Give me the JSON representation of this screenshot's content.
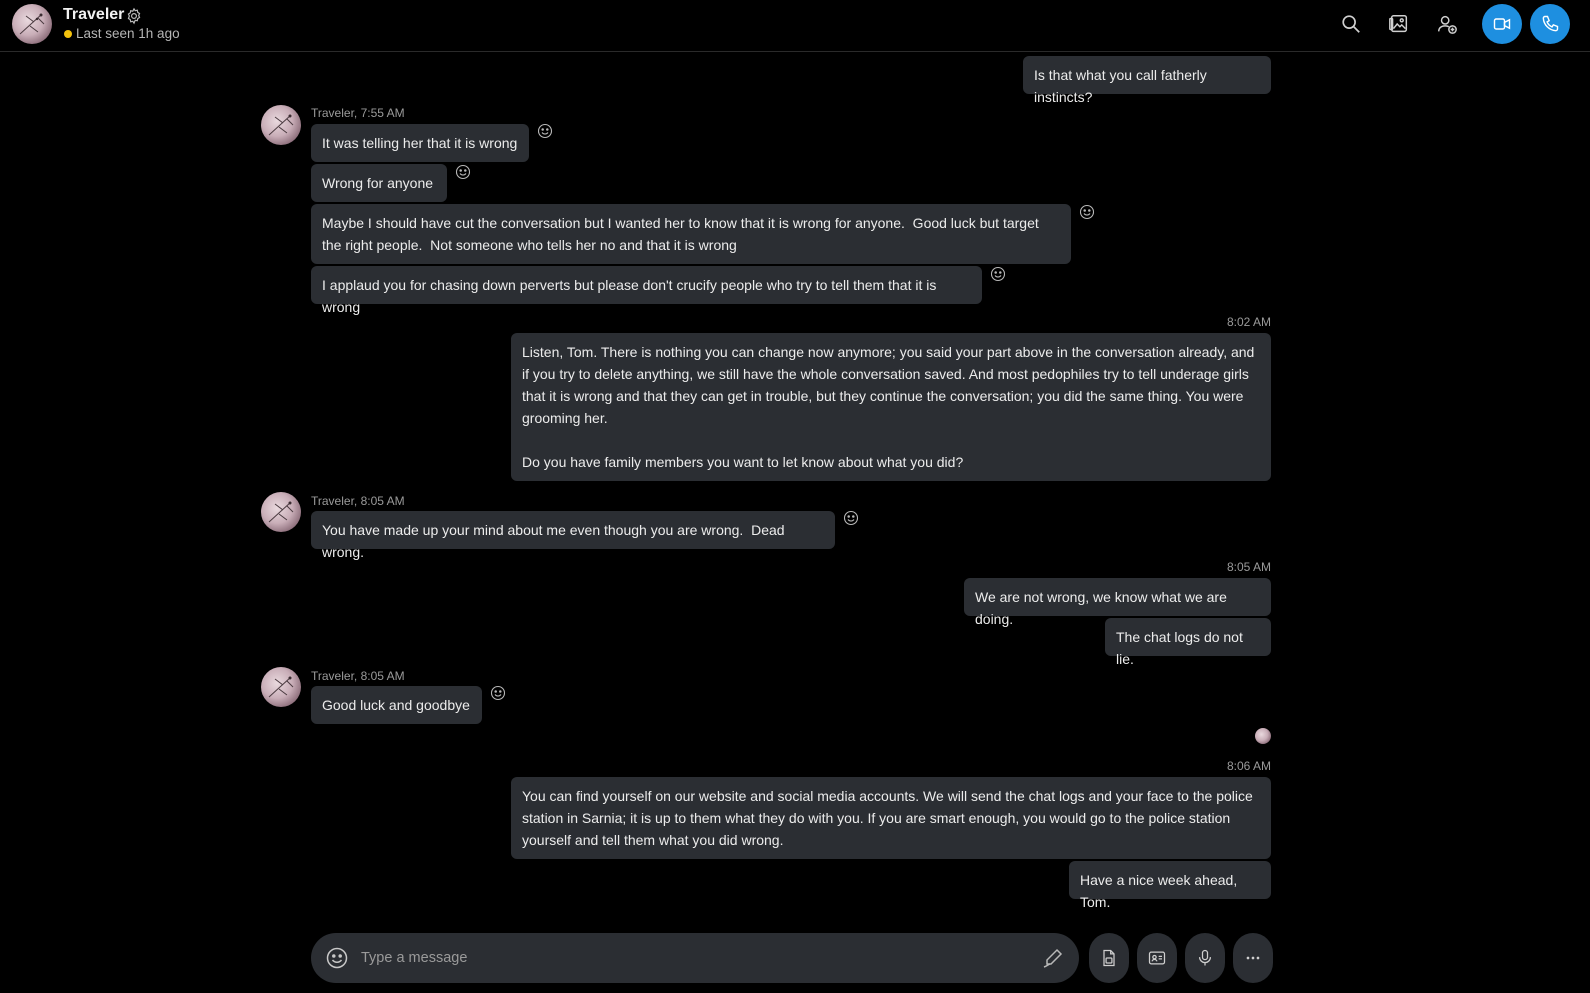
{
  "header": {
    "contact_name": "Traveler",
    "status": "Last seen 1h ago",
    "status_color": "#f4c20d",
    "icons": [
      "search-icon",
      "gallery-icon",
      "add-person-icon",
      "video-call-icon",
      "audio-call-icon"
    ],
    "call_button_color": "#1e8fe0"
  },
  "messages": {
    "m0": {
      "text": "Is that what you call fatherly instincts?"
    },
    "g1": {
      "meta": "Traveler, 7:55 AM",
      "m1": "It was telling her that it is wrong",
      "m2": "Wrong for anyone",
      "m3": "Maybe I should have cut the conversation but I wanted her to know that it is wrong for anyone.  Good luck but target the right people.  Not someone who tells her no and that it is wrong",
      "m4": "I applaud you for chasing down perverts but please don't crucify people who try to tell them that it is wrong"
    },
    "g2": {
      "time": "8:02 AM",
      "m1": "Listen, Tom. There is nothing you can change now anymore; you said your part above in the conversation already, and if you try to delete anything, we still have the whole conversation saved. And most pedophiles try to tell underage girls that it is wrong and that they can get in trouble, but they continue the conversation; you did the same thing. You were grooming her.\n\nDo you have family members you want to let know about what you did?"
    },
    "g3": {
      "meta": "Traveler, 8:05 AM",
      "m1": "You have made up your mind about me even though you are wrong.  Dead wrong."
    },
    "g4": {
      "time": "8:05 AM",
      "m1": "We are not wrong, we know what we are doing.",
      "m2": "The chat logs do not lie."
    },
    "g5": {
      "meta": "Traveler, 8:05 AM",
      "m1": "Good luck and goodbye"
    },
    "g6": {
      "time": "8:06 AM",
      "m1": "You can find yourself on our website and social media accounts. We will send the chat logs and your face to the police station in Sarnia; it is up to them what they do with you. If you are smart enough, you would go to the police station yourself and tell them what you did wrong.",
      "m2": "Have a nice week ahead, Tom."
    }
  },
  "composer": {
    "placeholder": "Type a message",
    "buttons": [
      "file-icon",
      "contact-card-icon",
      "microphone-icon",
      "more-icon"
    ]
  }
}
